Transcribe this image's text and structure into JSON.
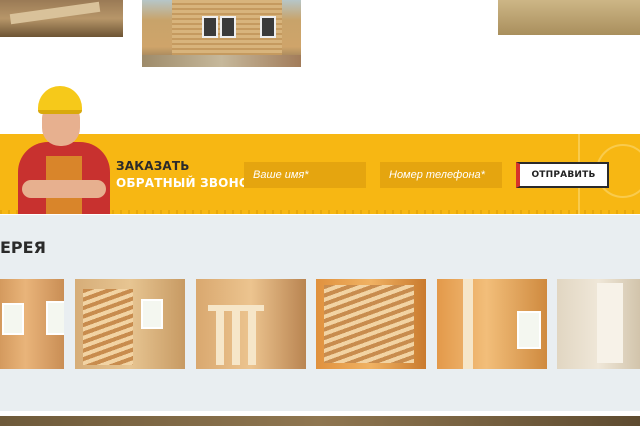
{
  "callback": {
    "title_line1": "ЗАКАЗАТЬ",
    "title_line2": "ОБРАТНЫЙ ЗВОНОК",
    "name_placeholder": "Ваше имя*",
    "phone_placeholder": "Номер телефона*",
    "submit_label": "ОТПРАВИТЬ"
  },
  "gallery": {
    "title": "ЕРЕЯ"
  },
  "colors": {
    "band": "#f7b713",
    "field": "#e5a50f",
    "accent_red": "#d6332b",
    "gallery_bg": "#e9eef1"
  }
}
